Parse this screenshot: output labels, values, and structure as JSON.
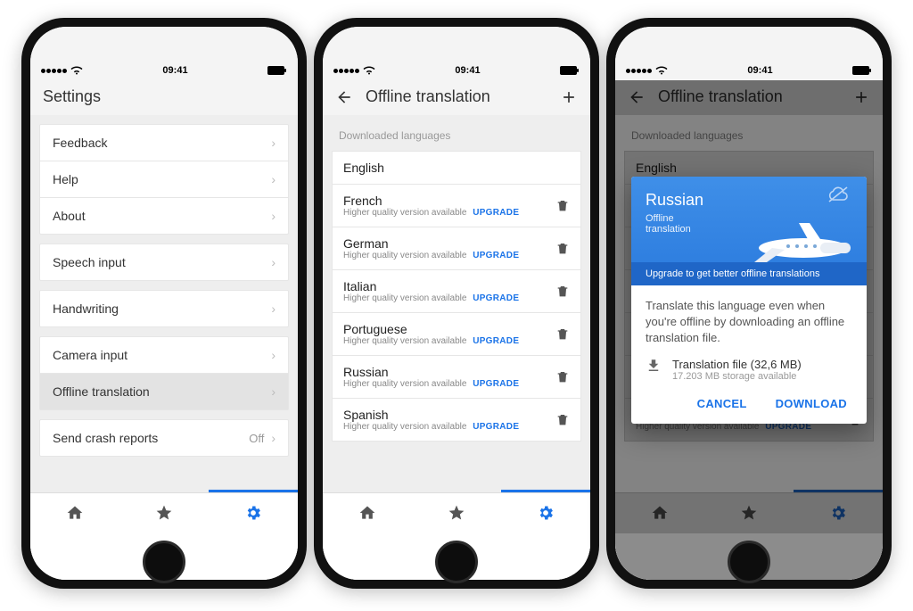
{
  "status": {
    "time": "09:41"
  },
  "screens": {
    "settings": {
      "title": "Settings",
      "groups": [
        {
          "items": [
            {
              "label": "Feedback"
            },
            {
              "label": "Help"
            },
            {
              "label": "About"
            }
          ]
        },
        {
          "items": [
            {
              "label": "Speech input"
            }
          ]
        },
        {
          "items": [
            {
              "label": "Handwriting"
            }
          ]
        },
        {
          "items": [
            {
              "label": "Camera input"
            },
            {
              "label": "Offline translation",
              "selected": true
            }
          ]
        },
        {
          "items": [
            {
              "label": "Send crash reports",
              "value": "Off"
            }
          ]
        }
      ]
    },
    "offline": {
      "title": "Offline translation",
      "section": "Downloaded languages",
      "upgrade_note": "Higher quality version available",
      "upgrade_action": "UPGRADE",
      "languages": [
        {
          "name": "English",
          "deletable": false,
          "upgradable": false
        },
        {
          "name": "French",
          "deletable": true,
          "upgradable": true
        },
        {
          "name": "German",
          "deletable": true,
          "upgradable": true
        },
        {
          "name": "Italian",
          "deletable": true,
          "upgradable": true
        },
        {
          "name": "Portuguese",
          "deletable": true,
          "upgradable": true
        },
        {
          "name": "Russian",
          "deletable": true,
          "upgradable": true
        },
        {
          "name": "Spanish",
          "deletable": true,
          "upgradable": true
        }
      ]
    },
    "dialog": {
      "language": "Russian",
      "subtitle": "Offline\ntranslation",
      "strip": "Upgrade to get better offline translations",
      "body": "Translate this language even when you're offline by downloading an offline translation file.",
      "file_label": "Translation file (32,6 MB)",
      "storage": "17.203 MB storage available",
      "cancel": "CANCEL",
      "download": "DOWNLOAD"
    }
  },
  "nav": {
    "home": "home",
    "star": "star",
    "settings": "settings"
  }
}
